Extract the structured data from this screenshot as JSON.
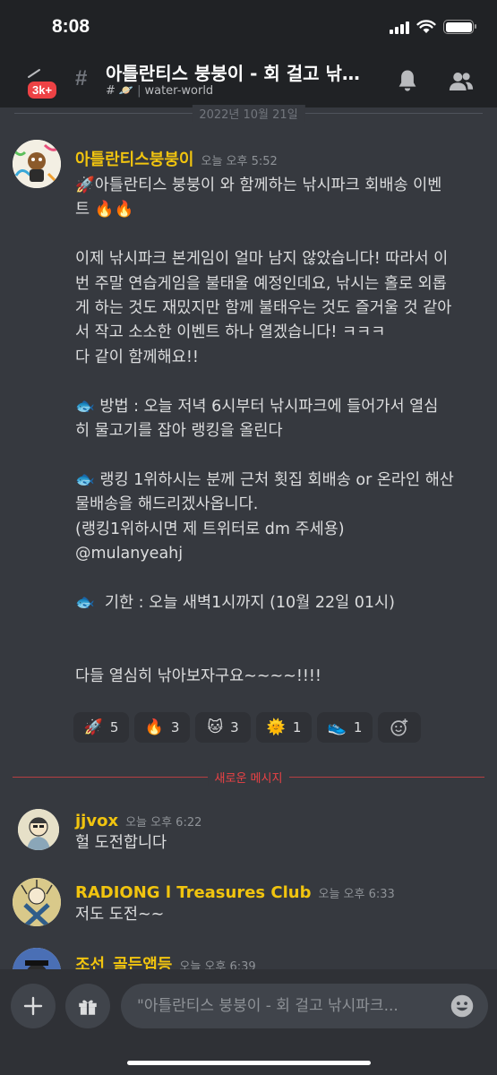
{
  "status_bar": {
    "time": "8:08"
  },
  "header": {
    "badge": "3k+",
    "channel_title": "아틀란티스 붕붕이 - 회 걸고 낚…",
    "channel_sub_prefix": "#",
    "channel_category": "water-world"
  },
  "date_divider": "2022년 10월 21일",
  "messages": [
    {
      "author": "아틀란티스붕붕이",
      "timestamp": "오늘 오후 5:52",
      "author_color": "#f1c40f",
      "lines": [
        "🚀아틀란티스 붕붕이 와 함께하는 낚시파크 회배송 이벤",
        "트 🔥🔥",
        "",
        "이제 낚시파크 본게임이 얼마 남지 않았습니다! 따라서 이",
        "번 주말 연습게임을 불태울 예정인데요, 낚시는 홀로 외롭",
        "게 하는 것도 재밌지만 함께 불태우는 것도 즐거울 것 같아",
        "서 작고 소소한 이벤트 하나 열겠습니다! ㅋㅋㅋ",
        "다 같이 함께해요!!",
        "",
        "🐟 방법 : 오늘 저녁 6시부터 낚시파크에 들어가서 열심",
        "히 물고기를 잡아 랭킹을 올린다",
        "",
        "🐟 랭킹 1위하시는 분께 근처 횟집 회배송 or 온라인 해산",
        "물배송을 해드리겠사옵니다.",
        "(랭킹1위하시면 제 트위터로 dm 주세용)",
        "@mulanyeahj",
        "",
        "🐟  기한 : 오늘 새벽1시까지 (10월 22일 01시)",
        "",
        "",
        "다들 열심히 낚아보자구요~~~~!!!!"
      ],
      "reactions": [
        {
          "icon": "rocket-icon",
          "emoji": "🚀",
          "count": "5"
        },
        {
          "icon": "fire-icon",
          "emoji": "🔥",
          "count": "3"
        },
        {
          "icon": "custom-emoji-icon",
          "emoji": "🐱",
          "count": "3"
        },
        {
          "icon": "sun-icon",
          "emoji": "🌞",
          "count": "1"
        },
        {
          "icon": "shoe-icon",
          "emoji": "👟",
          "count": "1"
        }
      ]
    },
    {
      "author": "jjvox",
      "timestamp": "오늘 오후 6:22",
      "author_color": "#f1c40f",
      "text": "헐 도전합니다"
    },
    {
      "author": "RADIONG l Treasures Club",
      "timestamp": "오늘 오후 6:33",
      "author_color": "#f1c40f",
      "text": "저도 도전~~"
    },
    {
      "author": "조선_골든앱등",
      "timestamp": "오늘 오후 6:39",
      "author_color": "#f1c40f"
    }
  ],
  "new_messages_divider": "새로운 메시지",
  "composer": {
    "placeholder": "\"아틀란티스 붕붕이 - 회 걸고 낚시파크..."
  },
  "colors": {
    "background": "#36393f",
    "header": "#202225",
    "accent_yellow": "#f1c40f",
    "new_messages_red": "#ed4245"
  }
}
